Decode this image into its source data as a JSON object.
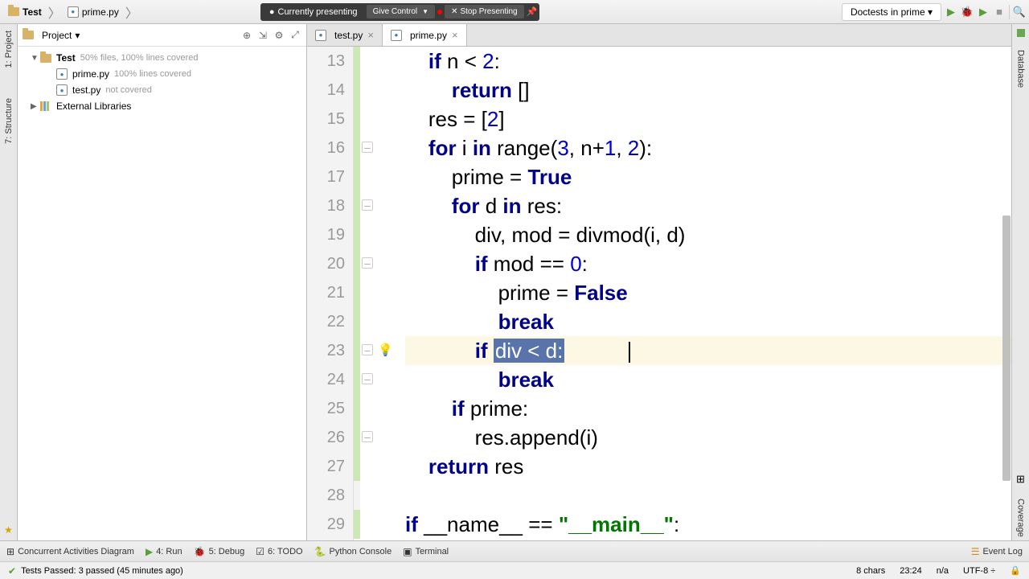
{
  "breadcrumb": {
    "project": "Test",
    "file": "prime.py"
  },
  "presenter": {
    "current": "Currently presenting",
    "give": "Give Control",
    "stop": "Stop Presenting"
  },
  "runConfig": "Doctests in prime",
  "sidebar": {
    "title": "Project",
    "tree": {
      "root": "Test",
      "rootHint": "50% files, 100% lines covered",
      "file1": "prime.py",
      "file1Hint": "100% lines covered",
      "file2": "test.py",
      "file2Hint": "not covered",
      "libs": "External Libraries"
    }
  },
  "leftRail": {
    "project": "1: Project",
    "structure": "7: Structure"
  },
  "rightRail": {
    "database": "Database",
    "coverage": "Coverage"
  },
  "tabs": [
    {
      "name": "test.py",
      "active": false
    },
    {
      "name": "prime.py",
      "active": true
    }
  ],
  "code": {
    "startLine": 13,
    "lines": [
      {
        "n": 13,
        "html": "    <span class='kw'>if</span> n &lt; <span class='num'>2</span>:"
      },
      {
        "n": 14,
        "html": "        <span class='kw'>return</span> []"
      },
      {
        "n": 15,
        "html": "    res = [<span class='num'>2</span>]"
      },
      {
        "n": 16,
        "html": "    <span class='kw'>for</span> i <span class='kw'>in</span> range(<span class='num'>3</span>, n+<span class='num'>1</span>, <span class='num'>2</span>):"
      },
      {
        "n": 17,
        "html": "        prime = <span class='bool'>True</span>"
      },
      {
        "n": 18,
        "html": "        <span class='kw'>for</span> d <span class='kw'>in</span> res:"
      },
      {
        "n": 19,
        "html": "            div, mod = divmod(i, d)"
      },
      {
        "n": 20,
        "html": "            <span class='kw'>if</span> mod == <span class='num'>0</span>:"
      },
      {
        "n": 21,
        "html": "                prime = <span class='bool'>False</span>"
      },
      {
        "n": 22,
        "html": "                <span class='kw'>break</span>"
      },
      {
        "n": 23,
        "html": "            <span class='kw'>if</span> <span class='sel'>div &lt; d:</span><span class='cursor'></span>",
        "hl": true,
        "bulb": true
      },
      {
        "n": 24,
        "html": "                <span class='kw'>break</span>"
      },
      {
        "n": 25,
        "html": "        <span class='kw'>if</span> prime:"
      },
      {
        "n": 26,
        "html": "            res.append(i)"
      },
      {
        "n": 27,
        "html": "    <span class='kw'>return</span> res"
      },
      {
        "n": 28,
        "html": ""
      },
      {
        "n": 29,
        "html": "<span class='kw'>if</span> __name__ == <span class='str'>\"__main__\"</span>:"
      }
    ],
    "folds": [
      16,
      18,
      20,
      23,
      24,
      26
    ]
  },
  "bottomBar": {
    "concurrent": "Concurrent Activities Diagram",
    "run": "4: Run",
    "debug": "5: Debug",
    "todo": "6: TODO",
    "console": "Python Console",
    "terminal": "Terminal",
    "eventLog": "Event Log"
  },
  "status": {
    "tests": "Tests Passed: 3 passed (45 minutes ago)",
    "chars": "8 chars",
    "pos": "23:24",
    "insert": "n/a",
    "encoding": "UTF-8"
  }
}
